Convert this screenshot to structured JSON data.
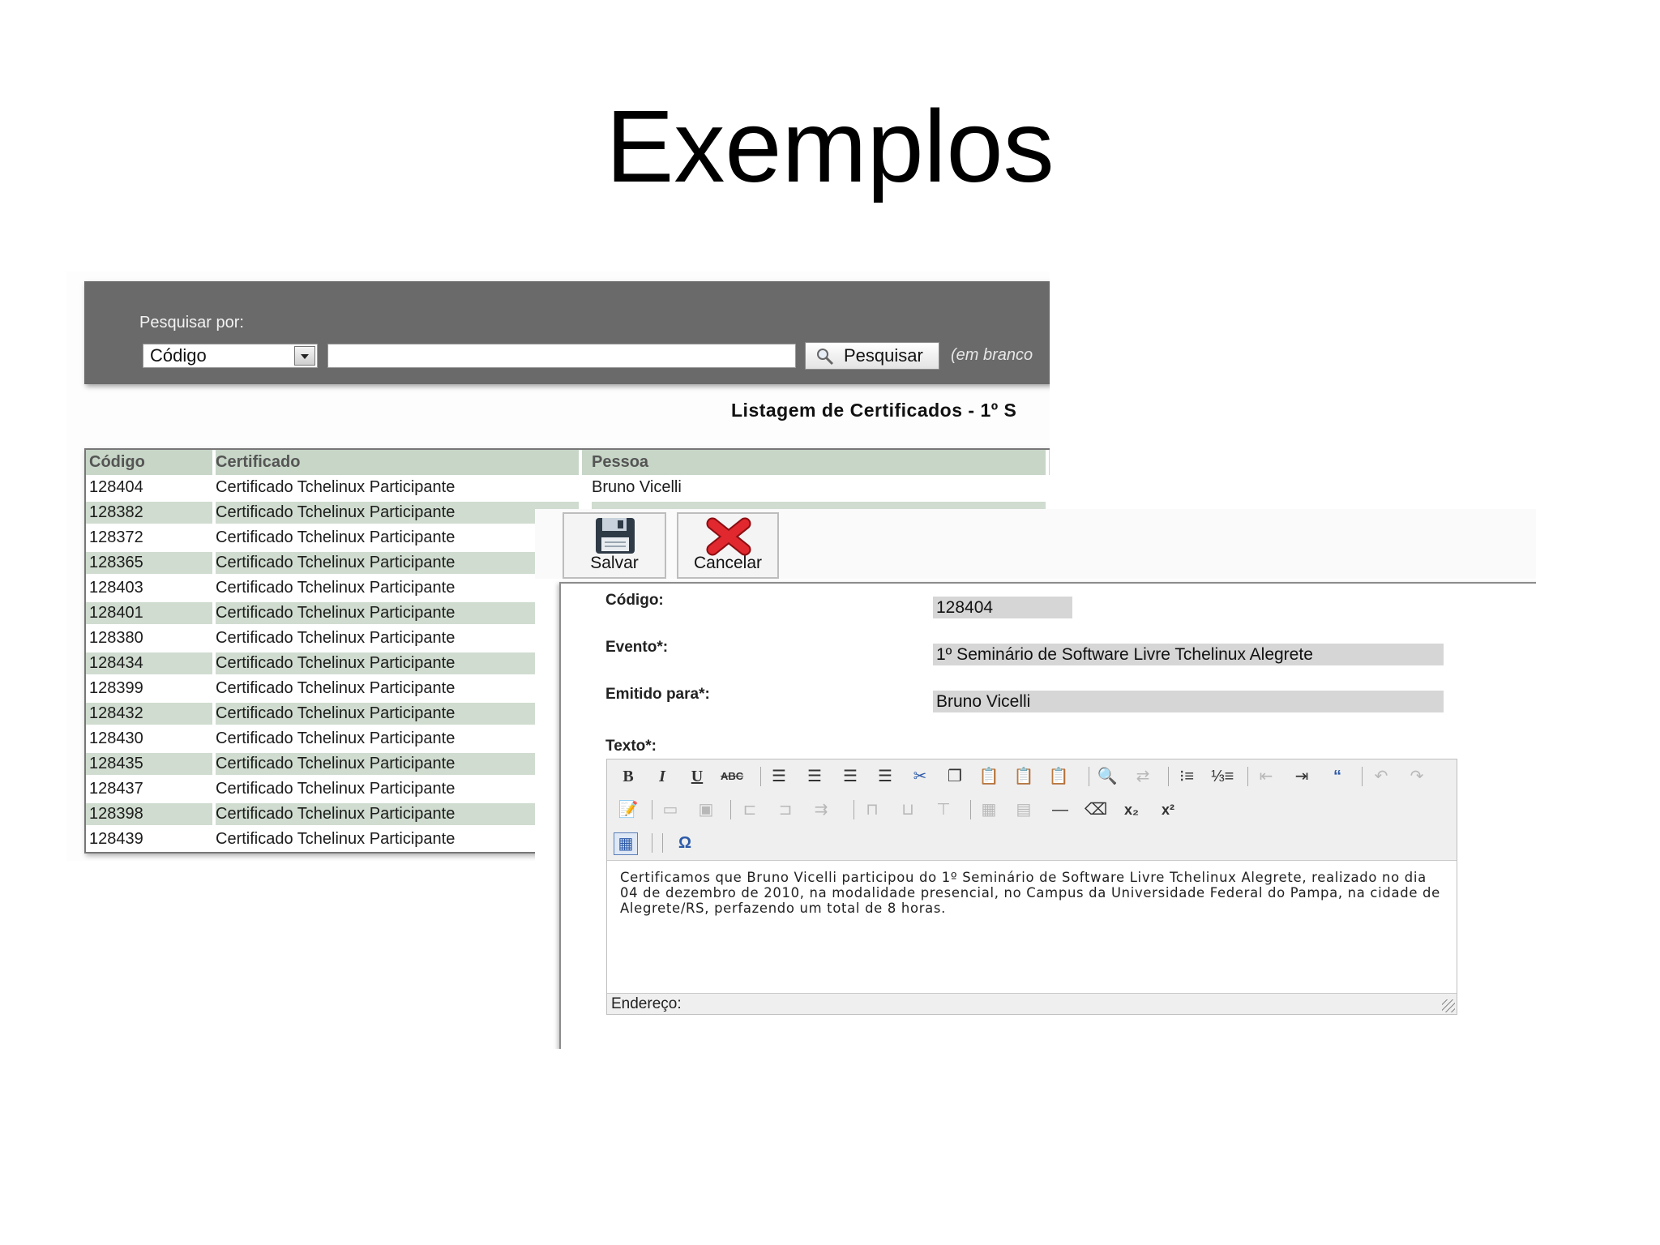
{
  "slide": {
    "title": "Exemplos"
  },
  "search": {
    "label": "Pesquisar por:",
    "select_value": "Código",
    "input_value": "",
    "button_label": "Pesquisar",
    "hint": "(em branco"
  },
  "list": {
    "title": "Listagem de Certificados - 1º S",
    "columns": [
      "Código",
      "Certificado",
      "Pessoa"
    ],
    "rows": [
      {
        "code": "128404",
        "certificate": "Certificado Tchelinux Participante",
        "person": "Bruno Vicelli"
      },
      {
        "code": "128382",
        "certificate": "Certificado Tchelinux Participante",
        "person": ""
      },
      {
        "code": "128372",
        "certificate": "Certificado Tchelinux Participante",
        "person": ""
      },
      {
        "code": "128365",
        "certificate": "Certificado Tchelinux Participante",
        "person": ""
      },
      {
        "code": "128403",
        "certificate": "Certificado Tchelinux Participante",
        "person": ""
      },
      {
        "code": "128401",
        "certificate": "Certificado Tchelinux Participante",
        "person": ""
      },
      {
        "code": "128380",
        "certificate": "Certificado Tchelinux Participante",
        "person": ""
      },
      {
        "code": "128434",
        "certificate": "Certificado Tchelinux Participante",
        "person": ""
      },
      {
        "code": "128399",
        "certificate": "Certificado Tchelinux Participante",
        "person": ""
      },
      {
        "code": "128432",
        "certificate": "Certificado Tchelinux Participante",
        "person": ""
      },
      {
        "code": "128430",
        "certificate": "Certificado Tchelinux Participante",
        "person": ""
      },
      {
        "code": "128435",
        "certificate": "Certificado Tchelinux Participante",
        "person": ""
      },
      {
        "code": "128437",
        "certificate": "Certificado Tchelinux Participante",
        "person": ""
      },
      {
        "code": "128398",
        "certificate": "Certificado Tchelinux Participante",
        "person": ""
      },
      {
        "code": "128439",
        "certificate": "Certificado Tchelinux Participante",
        "person": ""
      }
    ]
  },
  "form": {
    "save_label": "Salvar",
    "cancel_label": "Cancelar",
    "code_label": "Código:",
    "code_value": "128404",
    "event_label": "Evento*:",
    "event_value": "1º Seminário de Software Livre Tchelinux Alegrete",
    "issued_label": "Emitido para*:",
    "issued_value": "Bruno Vicelli",
    "text_label": "Texto*:",
    "editor_text": "Certificamos que Bruno Vicelli participou do 1º Seminário de Software Livre Tchelinux Alegrete, realizado no dia 04 de dezembro de 2010, na modalidade presencial, no Campus da Universidade Federal do Pampa, na cidade de Alegrete/RS, perfazendo um total de 8 horas.",
    "status_label": "Endereço:"
  },
  "colors": {
    "panel": "#6a6a6a",
    "row_highlight": "#cfdccf",
    "header": "#c7d6c7",
    "field_bg": "#d6d6d6",
    "cancel_red": "#e0282e"
  }
}
